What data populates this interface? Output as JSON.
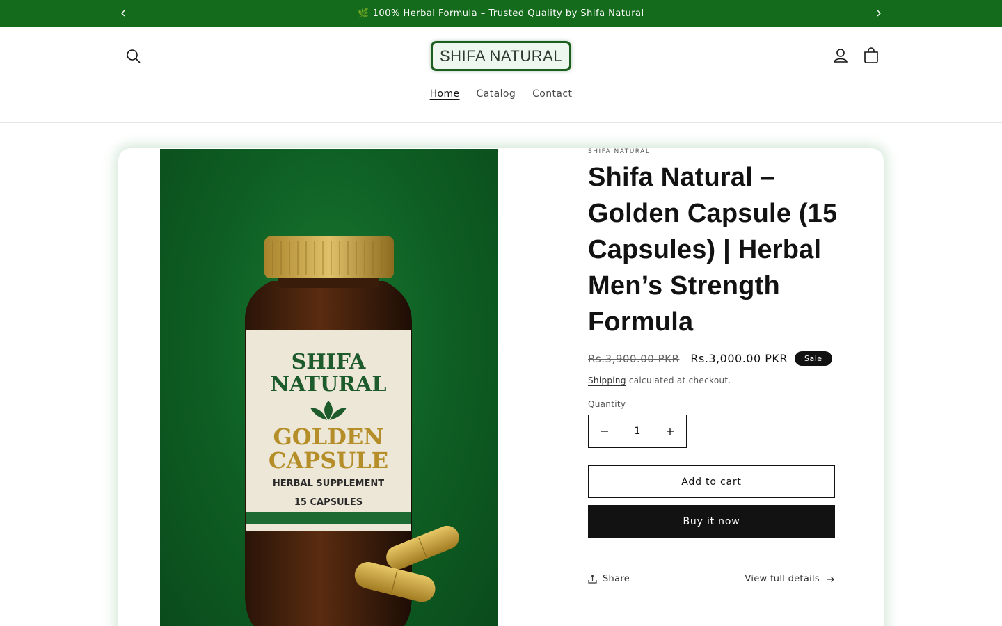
{
  "announcement": {
    "text": "🌿 100% Herbal Formula – Trusted Quality by Shifa Natural"
  },
  "header": {
    "logo_text": "SHIFA NATURAL",
    "nav": [
      {
        "label": "Home"
      },
      {
        "label": "Catalog"
      },
      {
        "label": "Contact"
      }
    ]
  },
  "product": {
    "vendor": "SHIFA NATURAL",
    "title": "Shifa Natural – Golden Capsule (15 Capsules) | Herbal Men’s Strength Formula",
    "price_compare": "Rs.3,900.00 PKR",
    "price": "Rs.3,000.00 PKR",
    "badge": "Sale",
    "shipping_link": "Shipping",
    "shipping_rest": " calculated at checkout.",
    "quantity_label": "Quantity",
    "quantity_value": "1",
    "add_to_cart": "Add to cart",
    "buy_now": "Buy it now",
    "share": "Share",
    "view_details": "View full details",
    "image_label": {
      "brand_line1": "SHIFA",
      "brand_line2": "NATURAL",
      "name_line1": "GOLDEN",
      "name_line2": "CAPSULE",
      "sub": "HERBAL SUPPLEMENT",
      "count": "15 CAPSULES"
    }
  },
  "colors": {
    "announcement_bg": "#156b1c",
    "logo_border": "#1b5e20",
    "badge_bg": "#121212",
    "image_bg": "#0f6125",
    "label_gold": "#b58e2a"
  }
}
